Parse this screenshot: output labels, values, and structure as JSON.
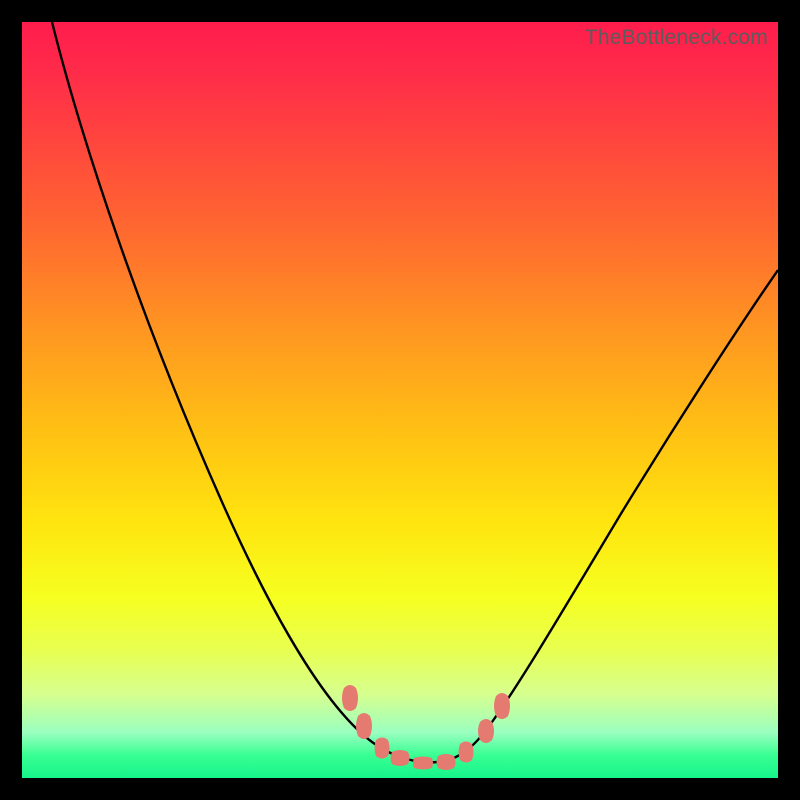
{
  "watermark": "TheBottleneck.com",
  "colors": {
    "bead_fill": "#e47a70",
    "curve_stroke": "#000000",
    "frame": "#000000"
  },
  "chart_data": {
    "type": "line",
    "title": "",
    "xlabel": "",
    "ylabel": "",
    "xlim": [
      0,
      100
    ],
    "ylim": [
      0,
      100
    ],
    "grid": false,
    "legend": false,
    "series": [
      {
        "name": "bottleneck-curve",
        "x": [
          4,
          8,
          12,
          16,
          20,
          24,
          28,
          32,
          36,
          40,
          44,
          47,
          49,
          51,
          53,
          55,
          58,
          62,
          68,
          75,
          82,
          90,
          98,
          100
        ],
        "y": [
          100,
          92,
          84,
          76,
          68,
          59,
          50,
          41,
          32,
          24,
          16,
          10,
          6,
          4,
          3,
          3.5,
          5,
          9,
          18,
          30,
          42,
          54,
          66,
          70
        ]
      }
    ],
    "markers": {
      "name": "trough-beads",
      "shape": "rounded-oval",
      "fill": "#e47a70",
      "points_index_range": [
        11,
        17
      ],
      "x": [
        46,
        48,
        50,
        52,
        54,
        56,
        58
      ],
      "y": [
        11,
        7,
        4.5,
        3.2,
        3.2,
        4.5,
        7
      ]
    }
  }
}
